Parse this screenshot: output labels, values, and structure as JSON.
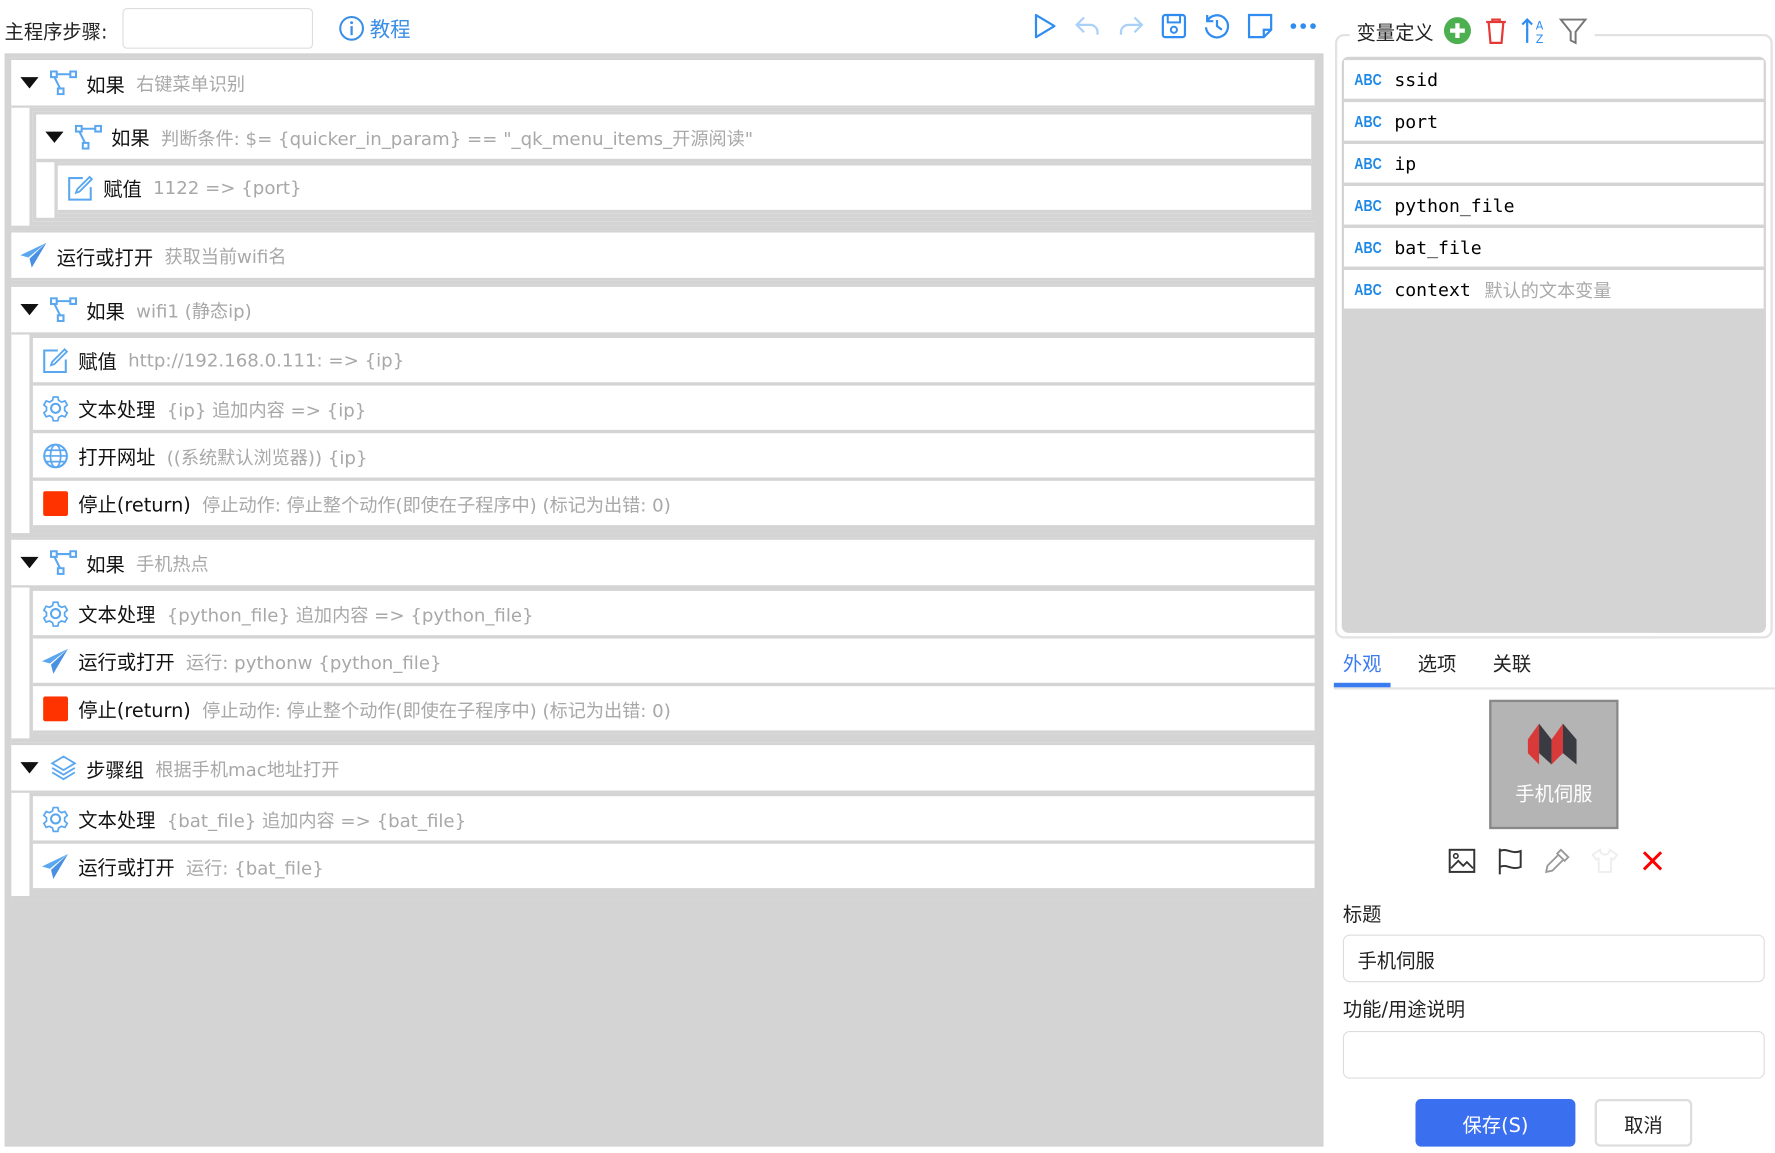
{
  "toolbar": {
    "main_steps_label": "主程序步骤:",
    "main_steps_value": "",
    "tutorial_label": "教程",
    "icons": [
      "play-icon",
      "undo-icon",
      "redo-icon",
      "save-icon",
      "history-icon",
      "note-icon",
      "more-icon"
    ]
  },
  "steps": [
    {
      "kind": "if",
      "title": "如果",
      "desc": "右键菜单识别",
      "icon": "branch-icon",
      "children": [
        {
          "kind": "if",
          "title": "如果",
          "desc": "判断条件:  $= {quicker_in_param} == \"_qk_menu_items_开源阅读\"",
          "icon": "branch-icon",
          "children": [
            {
              "title": "赋值",
              "desc": "1122 => {port}",
              "icon": "edit-icon"
            }
          ]
        }
      ]
    },
    {
      "title": "运行或打开",
      "desc": "获取当前wifi名",
      "icon": "send-icon",
      "top": true
    },
    {
      "kind": "if",
      "title": "如果",
      "desc": "wifi1 (静态ip)",
      "icon": "branch-icon",
      "children": [
        {
          "title": "赋值",
          "desc": "http://192.168.0.111: => {ip}",
          "icon": "edit-icon"
        },
        {
          "title": "文本处理",
          "desc": "{ip} 追加内容 => {ip}",
          "icon": "gear-icon"
        },
        {
          "title": "打开网址",
          "desc": "((系统默认浏览器)) {ip}",
          "icon": "globe-icon"
        },
        {
          "title": "停止(return)",
          "desc": "停止动作:  停止整个动作(即使在子程序中) (标记为出错:  0)",
          "icon": "stop-icon"
        }
      ]
    },
    {
      "kind": "if",
      "title": "如果",
      "desc": "手机热点",
      "icon": "branch-icon",
      "children": [
        {
          "title": "文本处理",
          "desc": "{python_file} 追加内容 => {python_file}",
          "icon": "gear-icon"
        },
        {
          "title": "运行或打开",
          "desc": "运行:  pythonw {python_file}",
          "icon": "send-icon"
        },
        {
          "title": "停止(return)",
          "desc": "停止动作:  停止整个动作(即使在子程序中) (标记为出错:  0)",
          "icon": "stop-icon"
        }
      ]
    },
    {
      "kind": "group",
      "title": "步骤组",
      "desc": "根据手机mac地址打开",
      "icon": "layers-icon",
      "children": [
        {
          "title": "文本处理",
          "desc": "{bat_file} 追加内容 => {bat_file}",
          "icon": "gear-icon"
        },
        {
          "title": "运行或打开",
          "desc": "运行:  {bat_file}",
          "icon": "send-icon"
        }
      ]
    }
  ],
  "variables": {
    "header": "变量定义",
    "type_badge": "ABC",
    "items": [
      {
        "name": "ssid",
        "desc": ""
      },
      {
        "name": "port",
        "desc": ""
      },
      {
        "name": "ip",
        "desc": ""
      },
      {
        "name": "python_file",
        "desc": ""
      },
      {
        "name": "bat_file",
        "desc": ""
      },
      {
        "name": "context",
        "desc": "默认的文本变量"
      }
    ]
  },
  "tabs": [
    {
      "label": "外观",
      "active": true
    },
    {
      "label": "选项"
    },
    {
      "label": "关联"
    }
  ],
  "appearance": {
    "preview_label": "手机伺服",
    "title_label": "标题",
    "title_value": "手机伺服",
    "desc_label": "功能/用途说明",
    "desc_value": ""
  },
  "buttons": {
    "save": "保存(S)",
    "cancel": "取消"
  },
  "colors": {
    "accent": "#3a7cf0",
    "icon_blue": "#5aa7f0",
    "stop_red": "#ff3300",
    "add_green": "#4caf50",
    "delete_red": "#e53935"
  }
}
